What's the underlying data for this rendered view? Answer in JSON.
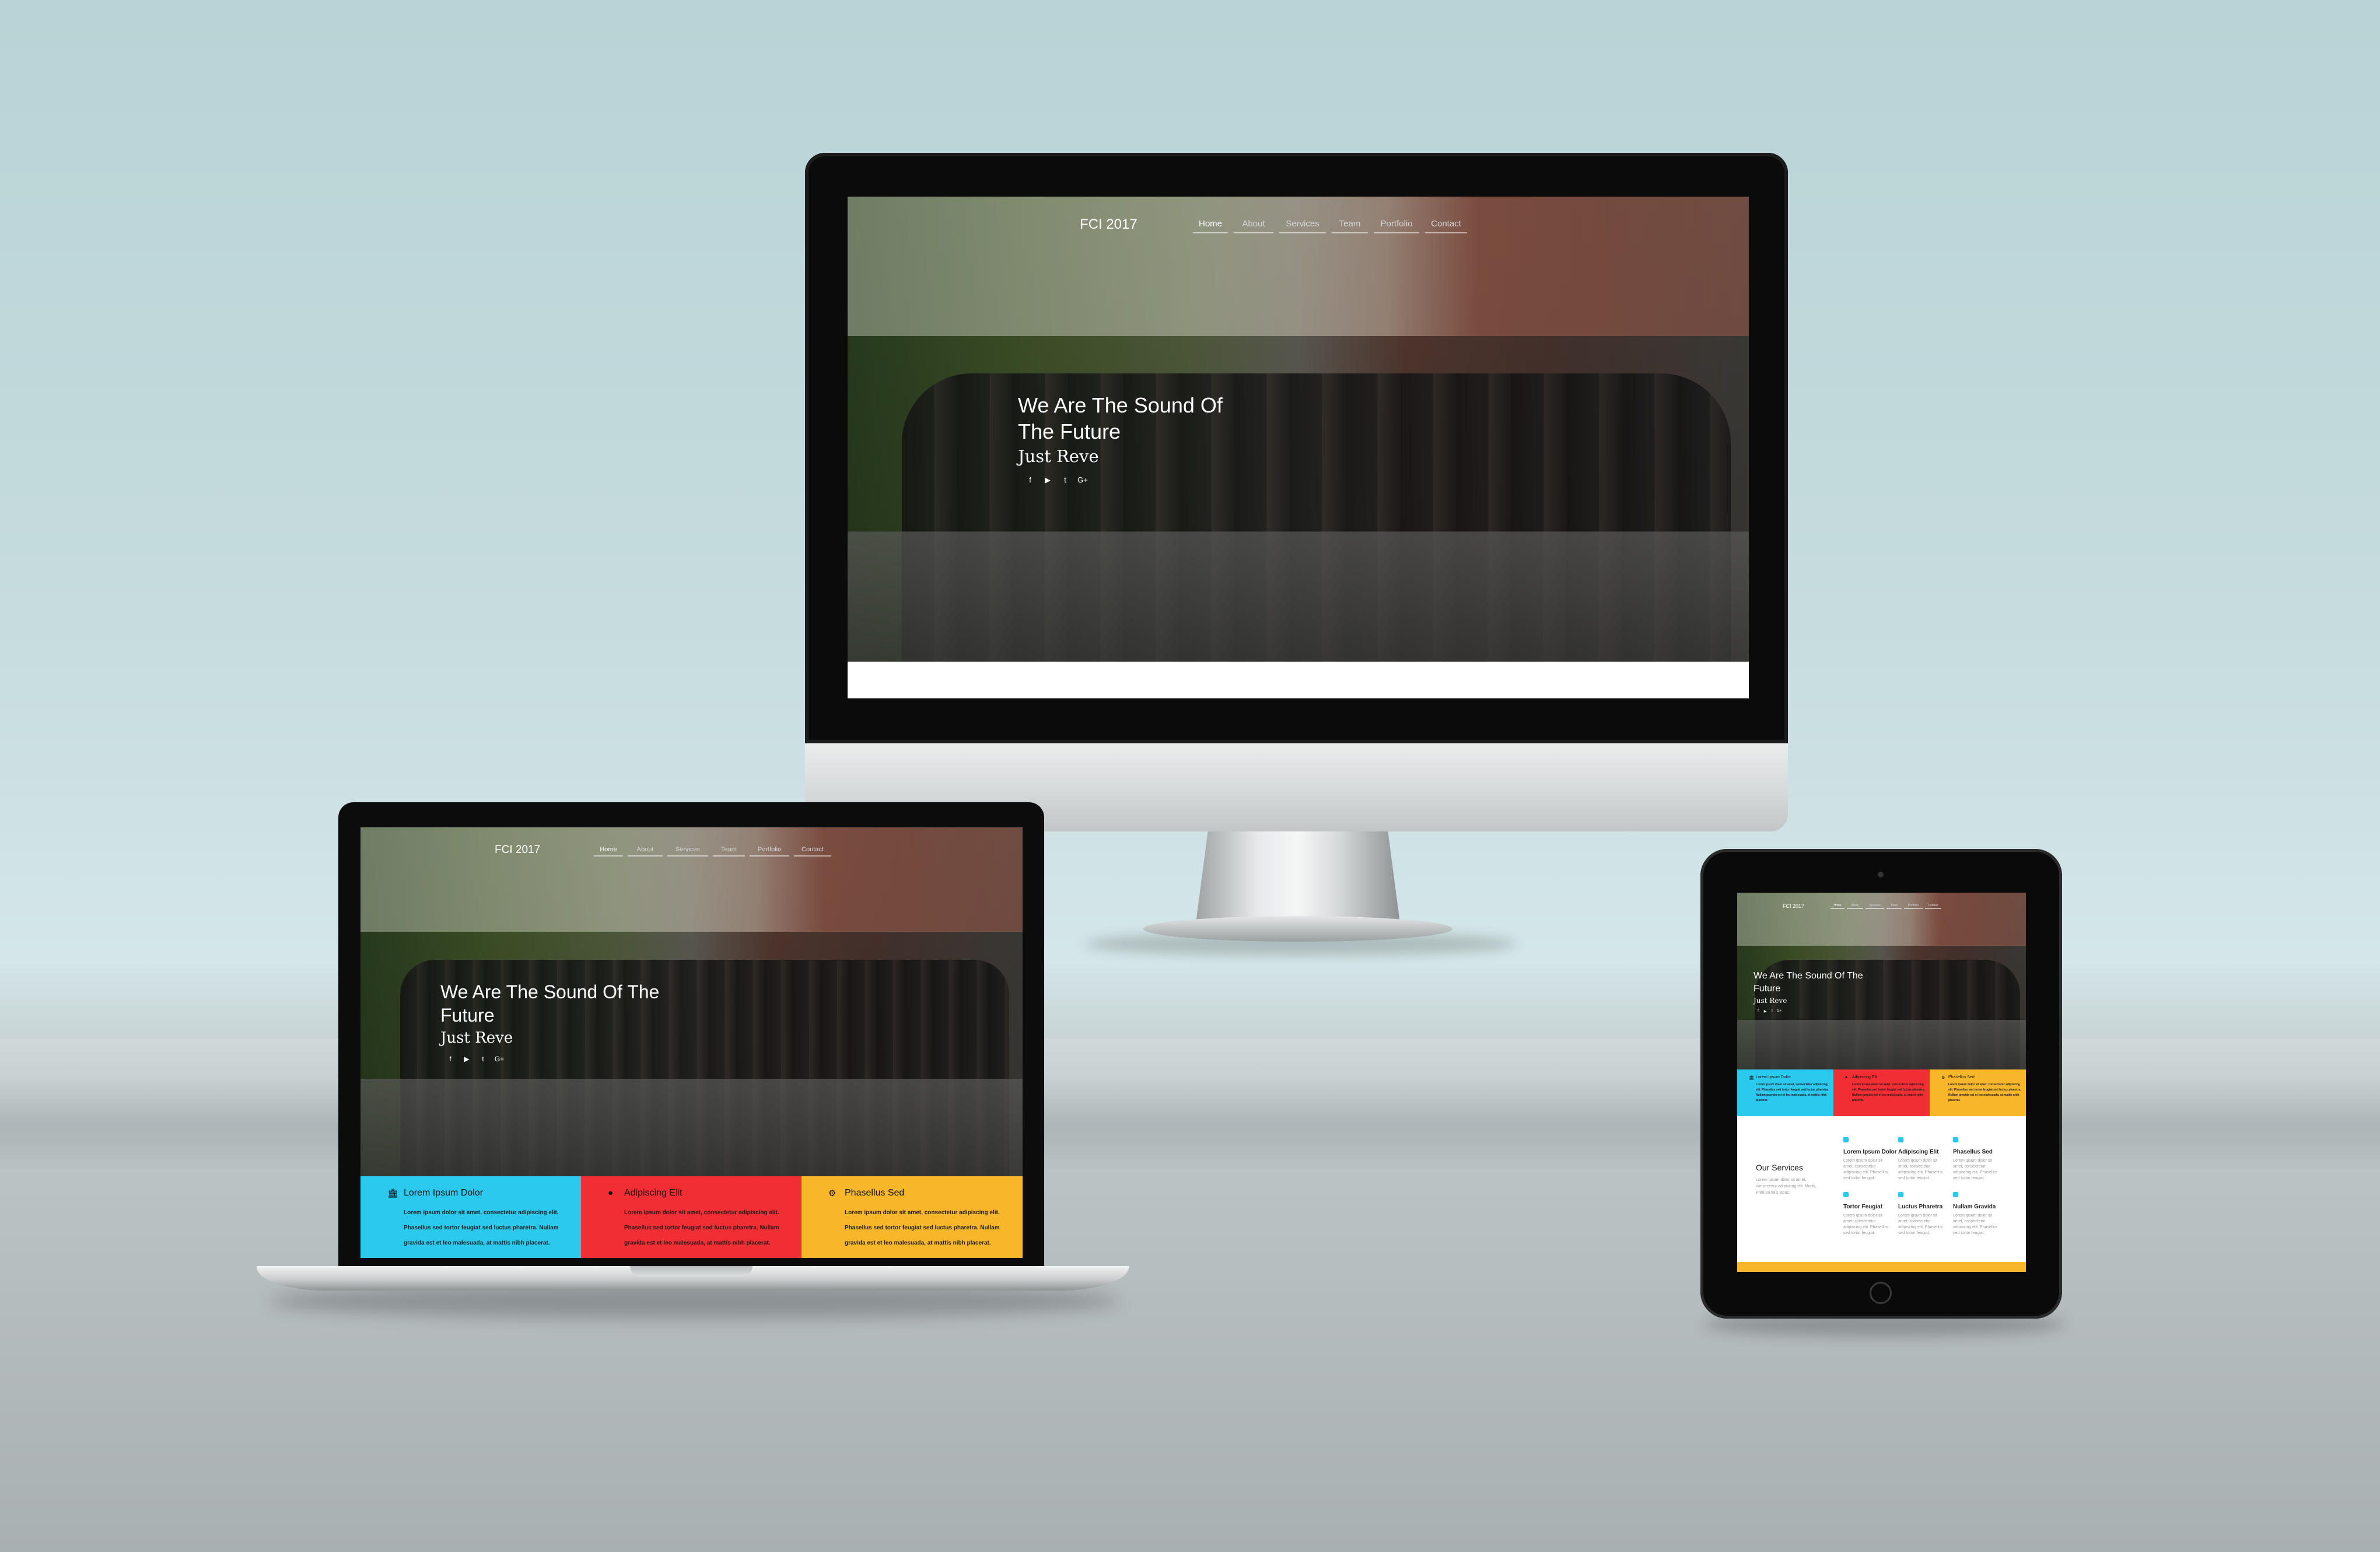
{
  "site": {
    "brand": "FCI 2017",
    "nav": [
      "Home",
      "About",
      "Services",
      "Team",
      "Portfolio",
      "Contact"
    ],
    "hero_title": "We Are The Sound Of The Future",
    "hero_subtitle": "Just Reve",
    "social_icons": [
      {
        "name": "facebook-icon",
        "glyph": "f"
      },
      {
        "name": "youtube-icon",
        "glyph": "▶"
      },
      {
        "name": "twitter-icon",
        "glyph": "t"
      },
      {
        "name": "google-plus-icon",
        "glyph": "G+"
      }
    ],
    "features": [
      {
        "icon": "bank-icon",
        "glyph": "🏛",
        "title": "Lorem Ipsum Dolor",
        "text": "Lorem ipsum dolor sit amet, consectetur adipiscing elit. Phasellus sed tortor feugiat sed luctus pharetra. Nullam gravida est et leo malesuada, at mattis nibh placerat.",
        "color": "#2bc9ee"
      },
      {
        "icon": "circle-icon",
        "glyph": "●",
        "title": "Adipiscing Elit",
        "text": "Lorem ipsum dolor sit amet, consectetur adipiscing elit. Phasellus sed tortor feugiat sed luctus pharetra. Nullam gravida est et leo malesuada, at mattis nibh placerat.",
        "color": "#f02e34"
      },
      {
        "icon": "gears-icon",
        "glyph": "⚙",
        "title": "Phasellus Sed",
        "text": "Lorem ipsum dolor sit amet, consectetur adipiscing elit. Phasellus sed tortor feugiat sed luctus pharetra. Nullam gravida est et leo malesuada, at mattis nibh placerat.",
        "color": "#f8b62a"
      }
    ],
    "services_heading": "Our Services",
    "services_intro": "Lorem ipsum dolor sit amet, consectetur adipiscing elit. Morbi, Pretium felis lacus.",
    "services": [
      {
        "title": "Lorem Ipsum Dolor",
        "text": "Lorem ipsum dolor sit amet, consectetur adipiscing elit. Phasellus sed tortor feugiat."
      },
      {
        "title": "Adipiscing Elit",
        "text": "Lorem ipsum dolor sit amet, consectetur adipiscing elit. Phasellus sed tortor feugiat."
      },
      {
        "title": "Phasellus Sed",
        "text": "Lorem ipsum dolor sit amet, consectetur adipiscing elit. Phasellus sed tortor feugiat."
      },
      {
        "title": "Tortor Feugiat",
        "text": "Lorem ipsum dolor sit amet, consectetur adipiscing elit. Phasellus sed tortor feugiat."
      },
      {
        "title": "Luctus Pharetra",
        "text": "Lorem ipsum dolor sit amet, consectetur adipiscing elit. Phasellus sed tortor feugiat."
      },
      {
        "title": "Nullam Gravida",
        "text": "Lorem ipsum dolor sit amet, consectetur adipiscing elit. Phasellus sed tortor feugiat."
      }
    ]
  },
  "colors": {
    "cyan": "#2bc9ee",
    "red": "#f02e34",
    "yellow": "#f8b62a"
  }
}
